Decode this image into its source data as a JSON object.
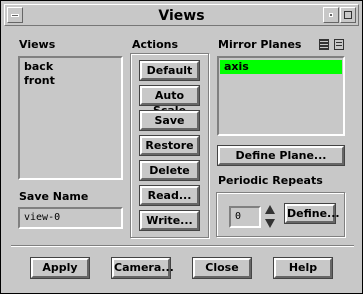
{
  "window": {
    "title": "Views"
  },
  "views": {
    "label": "Views",
    "items": [
      "back",
      "front"
    ]
  },
  "save_name": {
    "label": "Save Name",
    "value": "view-0"
  },
  "actions": {
    "label": "Actions",
    "buttons": [
      "Default",
      "Auto Scale",
      "Save",
      "Restore",
      "Delete",
      "Read...",
      "Write..."
    ]
  },
  "mirror_planes": {
    "label": "Mirror Planes",
    "items": [
      "axis"
    ],
    "selected": "axis",
    "define_plane": "Define Plane..."
  },
  "periodic": {
    "label": "Periodic Repeats",
    "value": "0",
    "define": "Define..."
  },
  "footer": {
    "apply": "Apply",
    "camera": "Camera...",
    "close": "Close",
    "help": "Help"
  },
  "colors": {
    "selection": "#00ff00",
    "background": "#c8c8c8"
  }
}
